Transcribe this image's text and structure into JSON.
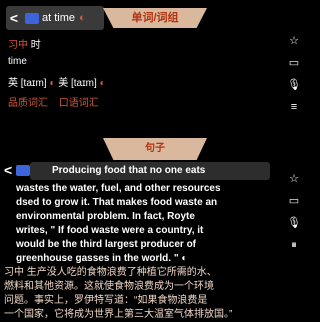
{
  "top_tab": "单词/词组",
  "word_row": {
    "back": "<",
    "word": "at time",
    "speaker": "◐"
  },
  "definitions": [
    {
      "pos": "习中",
      "meaning": "时",
      "extra": ""
    },
    {
      "label": "time"
    },
    {
      "uk": "英 [taɪm]",
      "us": "美 [taɪm]"
    }
  ],
  "tags": [
    "品质词汇",
    "口语词汇"
  ],
  "rail_icons": [
    "bookmark-icon",
    "message-icon",
    "microphone-icon",
    "menu-icon"
  ],
  "second_tab": "句子",
  "sentence_bar": {
    "back": "<",
    "text": "Producing food that no one eats"
  },
  "english_lines": [
    "wastes the water, fuel, and other resources",
    "dsed to grow it. That makes food waste an",
    "environmental problem. In fact, Royte",
    "writes, \" If food waste were a country, it",
    "would be the third largest producer of",
    "greenhouse gasses in the world. \" ◐"
  ],
  "chinese_lines": [
    "习中 生产没人吃的食物浪费了种植它所需的水、",
    "燃料和其他资源。这就使食物浪费成为一个环境",
    "问题。事实上，罗伊特写道：“如果食物浪费是",
    "一个国家，它将成为世界上第三大温室气体排放国。”"
  ],
  "rail2_icons": [
    "bookmark-icon",
    "message-icon",
    "microphone-icon",
    "pause-icon"
  ]
}
